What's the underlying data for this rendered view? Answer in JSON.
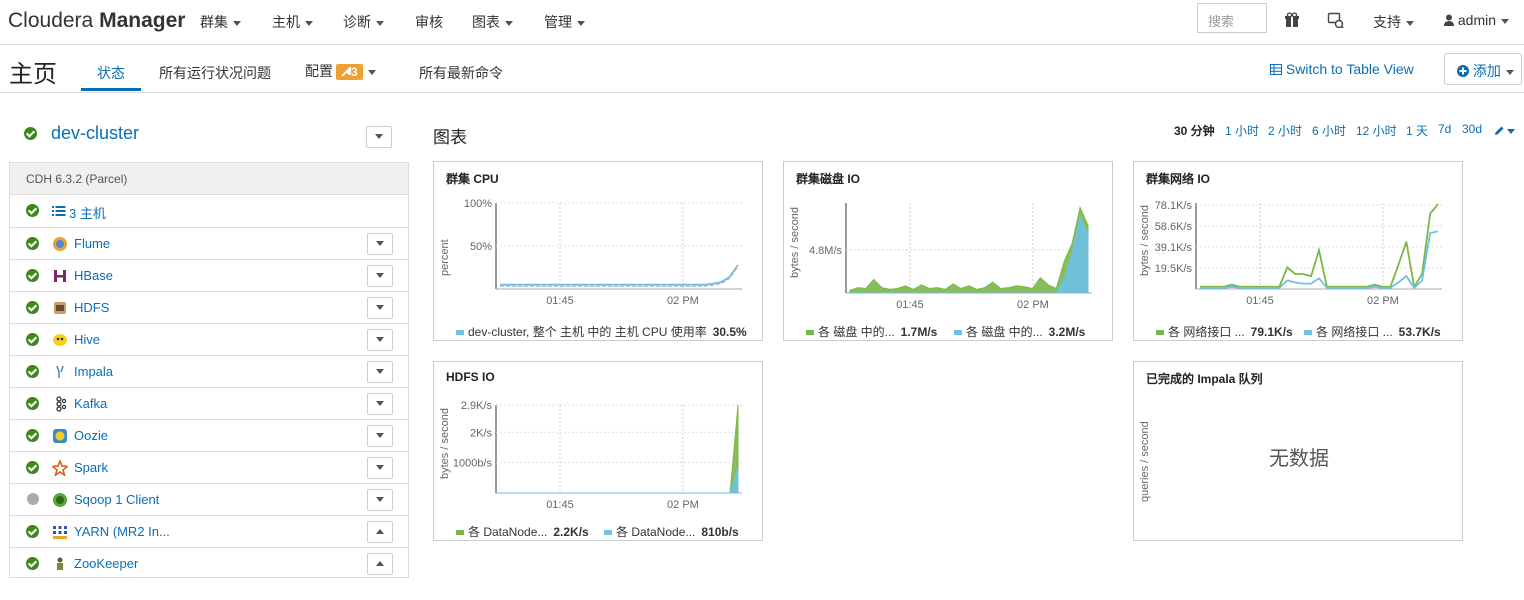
{
  "nav": {
    "brand_light": "Cloudera",
    "brand_bold": "Manager",
    "menus": [
      "群集",
      "主机",
      "诊断",
      "审核",
      "图表",
      "管理"
    ],
    "search_placeholder": "搜索",
    "support": "支持",
    "user": "admin"
  },
  "header": {
    "title": "主页",
    "tabs": [
      "状态",
      "所有运行状况问题",
      "配置",
      "所有最新命令"
    ],
    "config_badge": "3",
    "switch_view": "Switch to Table View",
    "add": "添加"
  },
  "cluster": {
    "name": "dev-cluster",
    "version": "CDH 6.3.2 (Parcel)",
    "hosts": "3 主机",
    "services": [
      {
        "name": "Flume",
        "status": "ok",
        "icon": "flume-icon"
      },
      {
        "name": "HBase",
        "status": "ok",
        "icon": "hbase-icon"
      },
      {
        "name": "HDFS",
        "status": "ok",
        "icon": "hdfs-icon"
      },
      {
        "name": "Hive",
        "status": "ok",
        "icon": "hive-icon"
      },
      {
        "name": "Impala",
        "status": "ok",
        "icon": "impala-icon"
      },
      {
        "name": "Kafka",
        "status": "ok",
        "icon": "kafka-icon"
      },
      {
        "name": "Oozie",
        "status": "ok",
        "icon": "oozie-icon"
      },
      {
        "name": "Spark",
        "status": "ok",
        "icon": "spark-icon"
      },
      {
        "name": "Sqoop 1 Client",
        "status": "unknown",
        "icon": "sqoop-icon"
      },
      {
        "name": "YARN (MR2 In...",
        "status": "ok",
        "icon": "yarn-icon"
      },
      {
        "name": "ZooKeeper",
        "status": "ok",
        "icon": "zookeeper-icon"
      }
    ]
  },
  "charts_header": {
    "title": "图表",
    "ranges": [
      "30 分钟",
      "1 小时",
      "2 小时",
      "6 小时",
      "12 小时",
      "1 天",
      "7d",
      "30d"
    ],
    "active_range": "30 分钟"
  },
  "colors": {
    "green": "#7ab648",
    "blue": "#6ec1e4",
    "link": "#0a6eb4"
  },
  "chart_data": [
    {
      "type": "line",
      "title": "群集 CPU",
      "ylabel": "percent",
      "yticks": [
        "100%",
        "50%"
      ],
      "xticks": [
        "01:45",
        "02 PM"
      ],
      "series": [
        {
          "name": "dev-cluster, 整个 主机 中的 主机 CPU 使用率",
          "value_label": "30.5%",
          "color": "#6ec1e4",
          "values": [
            5,
            5,
            5,
            5,
            5,
            5,
            5,
            5,
            5,
            5,
            5,
            5,
            5,
            5,
            5,
            5,
            5,
            5,
            5,
            5,
            5,
            5,
            5,
            5,
            5,
            6,
            8,
            14,
            28
          ]
        }
      ]
    },
    {
      "type": "area",
      "title": "群集磁盘 IO",
      "ylabel": "bytes / second",
      "yticks": [
        "4.8M/s"
      ],
      "xticks": [
        "01:45",
        "02 PM"
      ],
      "series": [
        {
          "name": "各 磁盘 中的...",
          "value_label": "1.7M/s",
          "color": "#7ab648",
          "values": [
            0.3,
            0.6,
            0.5,
            1.5,
            0.6,
            0.4,
            0.5,
            0.8,
            0.4,
            0.9,
            0.5,
            0.6,
            0.4,
            1.0,
            0.5,
            0.8,
            0.4,
            0.6,
            1.2,
            0.5,
            0.6,
            0.8,
            0.7,
            0.5,
            1.7,
            0.9,
            0.5,
            3.5,
            5.5,
            9.5,
            7.5
          ]
        },
        {
          "name": "各 磁盘 中的...",
          "value_label": "3.2M/s",
          "color": "#6ec1e4",
          "values": [
            0,
            0,
            0,
            0,
            0,
            0,
            0,
            0,
            0,
            0,
            0,
            0,
            0,
            0,
            0,
            0,
            0,
            0,
            0,
            0,
            0,
            0,
            0,
            0,
            0,
            0,
            0,
            1.5,
            4.5,
            8.5,
            6.5
          ]
        }
      ]
    },
    {
      "type": "line",
      "title": "群集网络 IO",
      "ylabel": "bytes / second",
      "yticks": [
        "78.1K/s",
        "58.6K/s",
        "39.1K/s",
        "19.5K/s"
      ],
      "xticks": [
        "01:45",
        "02 PM"
      ],
      "series": [
        {
          "name": "各 网络接口 ...",
          "value_label": "79.1K/s",
          "color": "#7ab648",
          "values": [
            2,
            2,
            2,
            2,
            4,
            2,
            2,
            2,
            2,
            2,
            2,
            20,
            14,
            14,
            12,
            36,
            2,
            2,
            2,
            2,
            2,
            2,
            4,
            2,
            2,
            22,
            44,
            2,
            14,
            70,
            79
          ]
        },
        {
          "name": "各 网络接口 ...",
          "value_label": "53.7K/s",
          "color": "#6ec1e4",
          "values": [
            1,
            1,
            1,
            1,
            2,
            1,
            1,
            1,
            1,
            1,
            1,
            8,
            6,
            5,
            5,
            10,
            1,
            1,
            1,
            1,
            1,
            1,
            2,
            1,
            1,
            6,
            12,
            1,
            8,
            52,
            53.7
          ]
        }
      ]
    },
    {
      "type": "area",
      "title": "HDFS IO",
      "ylabel": "bytes / second",
      "yticks": [
        "2.9K/s",
        "2K/s",
        "1000b/s"
      ],
      "xticks": [
        "01:45",
        "02 PM"
      ],
      "series": [
        {
          "name": "各 DataNode...",
          "value_label": "2.2K/s",
          "color": "#7ab648",
          "values": [
            0,
            0,
            0,
            0,
            0,
            0,
            0,
            0,
            0,
            0,
            0,
            0,
            0,
            0,
            0,
            0,
            0,
            0,
            0,
            0,
            0,
            0,
            0,
            0,
            0,
            0,
            0,
            0,
            0,
            0,
            2900
          ]
        },
        {
          "name": "各 DataNode...",
          "value_label": "810b/s",
          "color": "#6ec1e4",
          "values": [
            0,
            0,
            0,
            0,
            0,
            0,
            0,
            0,
            0,
            0,
            0,
            0,
            0,
            0,
            0,
            0,
            0,
            0,
            0,
            0,
            0,
            0,
            0,
            0,
            0,
            0,
            0,
            0,
            0,
            0,
            810
          ]
        }
      ]
    },
    {
      "type": "line",
      "title": "已完成的 Impala 队列",
      "ylabel": "queries / second",
      "empty_text": "无数据",
      "series": []
    }
  ]
}
